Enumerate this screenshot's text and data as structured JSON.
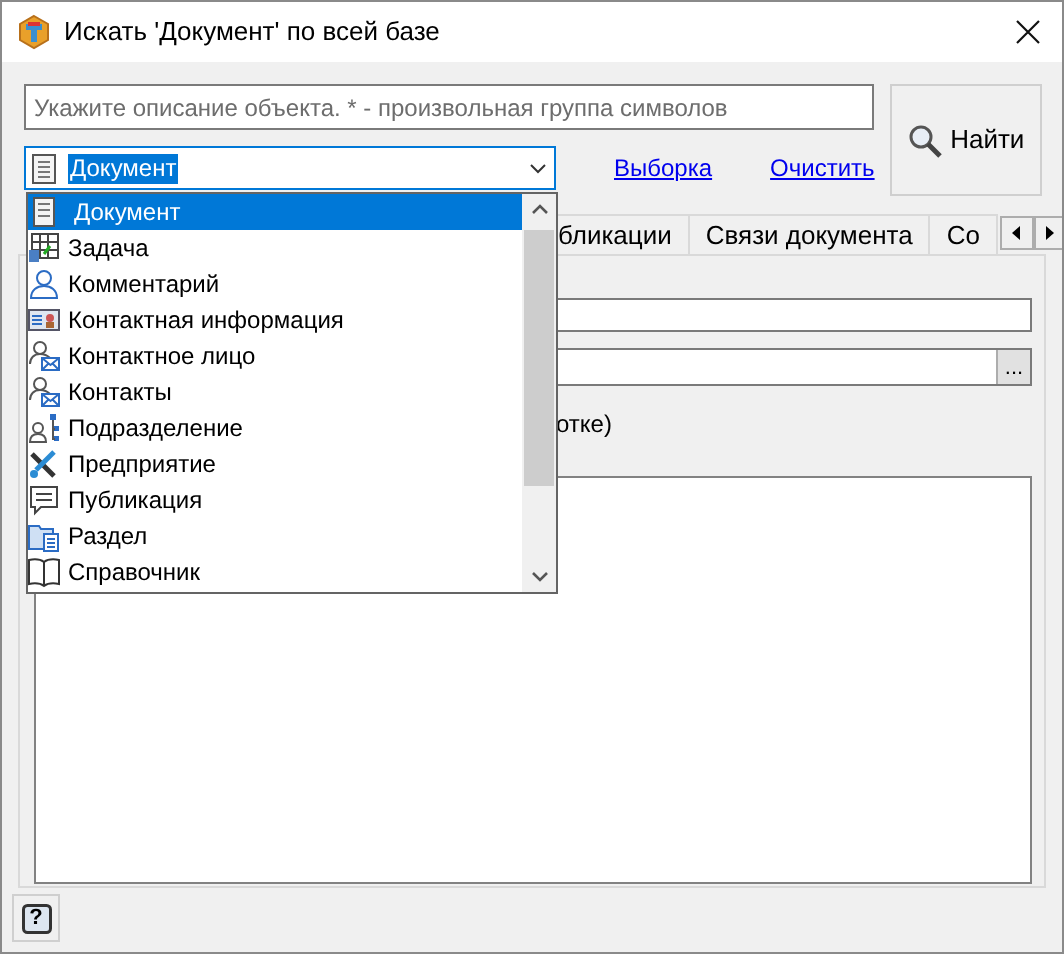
{
  "window": {
    "title": "Искать 'Документ' по всей базе"
  },
  "search": {
    "placeholder": "Укажите описание объекта. * - произвольная группа символов"
  },
  "type_combo": {
    "value": "Документ"
  },
  "links": [
    "Выборка",
    "Очистить"
  ],
  "find_button": "Найти",
  "tabs": [
    {
      "label": "бликации",
      "selected": false
    },
    {
      "label": "Связи документа",
      "selected": false
    },
    {
      "label": "Со",
      "selected": false
    }
  ],
  "panel": {
    "browse_button": "...",
    "text": "отке)"
  },
  "dropdown": {
    "items": [
      {
        "label": "Документ",
        "selected": true
      },
      {
        "label": "Задача",
        "selected": false
      },
      {
        "label": "Комментарий",
        "selected": false
      },
      {
        "label": "Контактная информация",
        "selected": false
      },
      {
        "label": "Контактное лицо",
        "selected": false
      },
      {
        "label": "Контакты",
        "selected": false
      },
      {
        "label": "Подразделение",
        "selected": false
      },
      {
        "label": "Предприятие",
        "selected": false
      },
      {
        "label": "Публикация",
        "selected": false
      },
      {
        "label": "Раздел",
        "selected": false
      },
      {
        "label": "Справочник",
        "selected": false
      }
    ]
  },
  "help_button": "?"
}
